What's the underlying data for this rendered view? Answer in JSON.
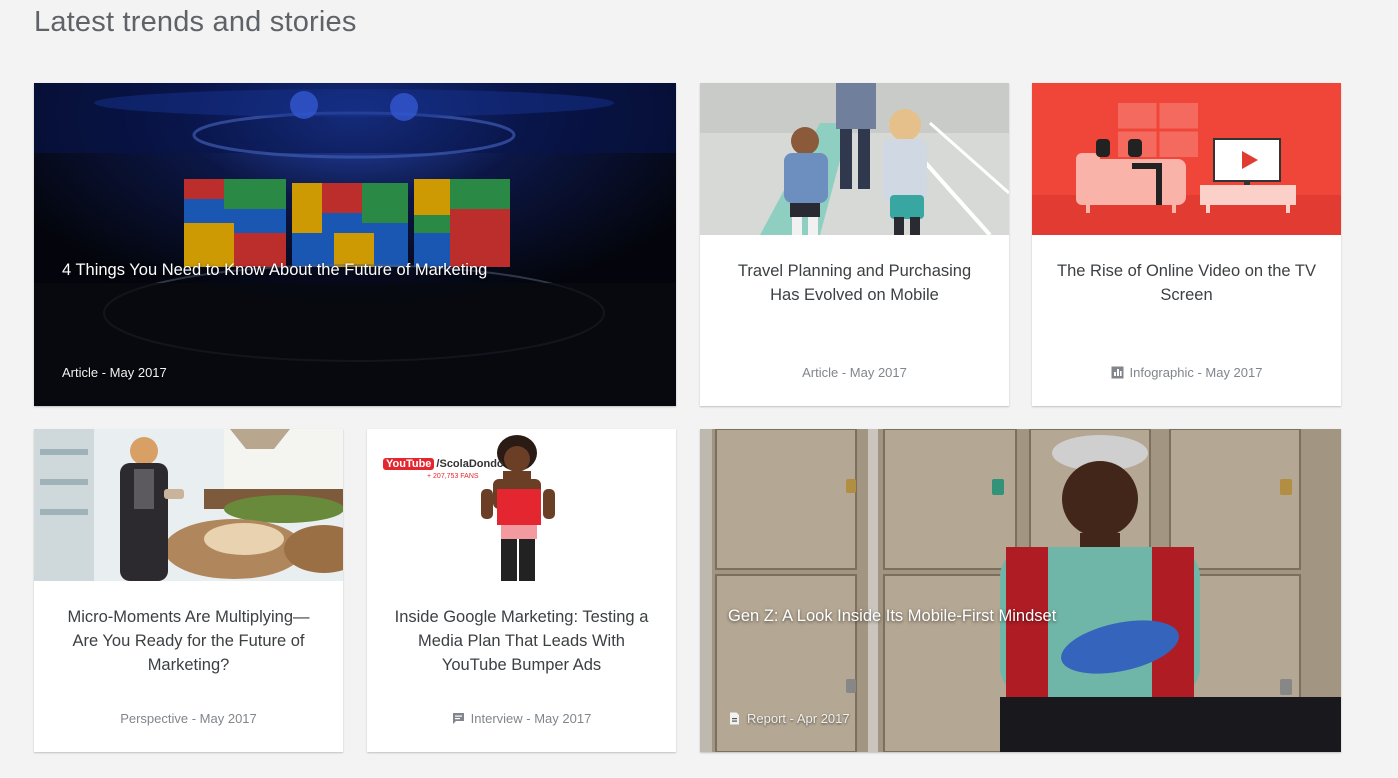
{
  "section": {
    "title": "Latest trends and stories"
  },
  "cards": [
    {
      "title": "4 Things You Need to Know About the Future of Marketing",
      "meta": "Article - May 2017",
      "meta_icon": "none"
    },
    {
      "title": "Travel Planning and Purchasing Has Evolved on Mobile",
      "meta": "Article - May 2017",
      "meta_icon": "none"
    },
    {
      "title": "The Rise of Online Video on the TV Screen",
      "meta": "Infographic - May 2017",
      "meta_icon": "infographic-icon"
    },
    {
      "title": "Micro-Moments Are Multiplying—Are You Ready for the Future of Marketing?",
      "meta": "Perspective - May 2017",
      "meta_icon": "none"
    },
    {
      "title": "Inside Google Marketing: Testing a Media Plan That Leads With YouTube Bumper Ads",
      "meta": "Interview - May 2017",
      "meta_icon": "interview-icon"
    },
    {
      "title": "Gen Z: A Look Inside Its Mobile-First Mindset",
      "meta": "Report - Apr 2017",
      "meta_icon": "report-icon"
    }
  ],
  "thumb_text": {
    "youtube_logo": "YouTube",
    "channel_name": "/ScolaDondo",
    "fans": "+ 207,753 FANS"
  },
  "colors": {
    "page_background": "#f3f3f3",
    "infographic_red": "#f0463a",
    "card_text": "#3c4043",
    "meta_text": "#80868b"
  }
}
